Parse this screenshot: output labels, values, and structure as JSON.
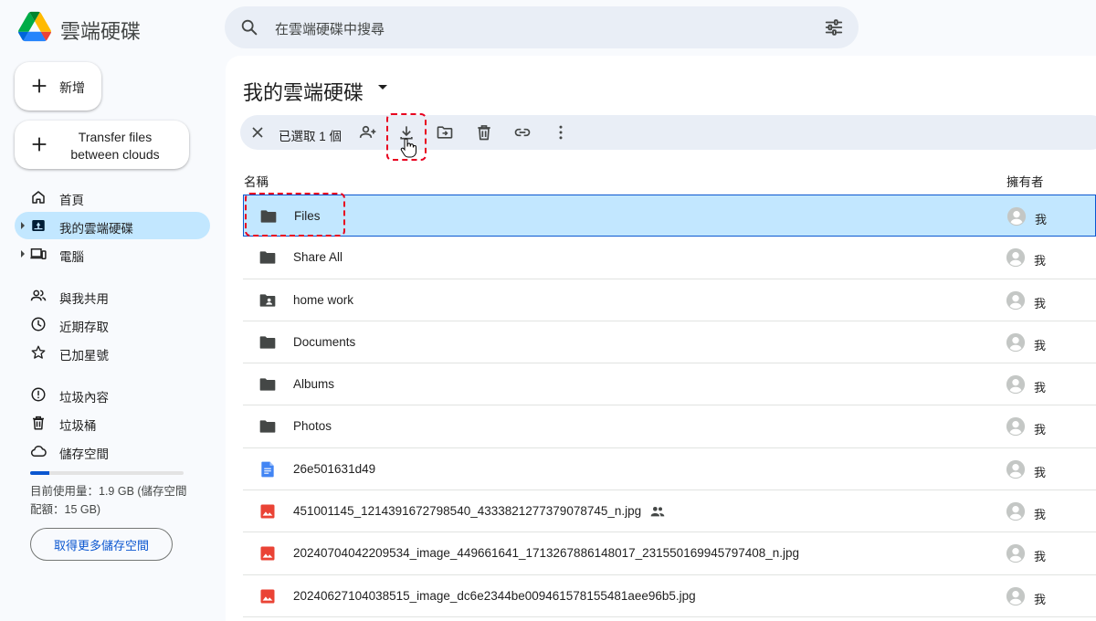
{
  "app": {
    "title": "雲端硬碟"
  },
  "search": {
    "placeholder": "在雲端硬碟中搜尋"
  },
  "sidebar": {
    "new_label": "新增",
    "transfer_label": "Transfer files between clouds",
    "items": [
      {
        "label": "首頁",
        "icon": "home-icon"
      },
      {
        "label": "我的雲端硬碟",
        "icon": "my-drive-icon",
        "active": true
      },
      {
        "label": "電腦",
        "icon": "computers-icon"
      },
      {
        "label": "與我共用",
        "icon": "shared-with-me-icon"
      },
      {
        "label": "近期存取",
        "icon": "recent-icon"
      },
      {
        "label": "已加星號",
        "icon": "star-icon"
      },
      {
        "label": "垃圾內容",
        "icon": "spam-icon"
      },
      {
        "label": "垃圾桶",
        "icon": "trash-icon"
      },
      {
        "label": "儲存空間",
        "icon": "cloud-icon"
      }
    ],
    "storage": {
      "used_fraction": 0.127,
      "text": "目前使用量：1.9 GB (儲存空間配額：15 GB)",
      "button": "取得更多儲存空間"
    }
  },
  "main": {
    "title": "我的雲端硬碟",
    "selection": {
      "count_label": "已選取 1 個"
    },
    "columns": {
      "name": "名稱",
      "owner": "擁有者"
    },
    "files": [
      {
        "name": "Files",
        "type": "folder",
        "owner": "我",
        "selected": true
      },
      {
        "name": "Share All",
        "type": "folder",
        "owner": "我"
      },
      {
        "name": "home work",
        "type": "shared-folder",
        "owner": "我"
      },
      {
        "name": "Documents",
        "type": "folder",
        "owner": "我"
      },
      {
        "name": "Albums",
        "type": "folder",
        "owner": "我"
      },
      {
        "name": "Photos",
        "type": "folder",
        "owner": "我"
      },
      {
        "name": "26e501631d49",
        "type": "doc",
        "owner": "我"
      },
      {
        "name": "451001145_1214391672798540_4333821277379078745_n.jpg",
        "type": "image",
        "owner": "我",
        "shared": true
      },
      {
        "name": "20240704042209534_image_449661641_1713267886148017_231550169945797408_n.jpg",
        "type": "image",
        "owner": "我"
      },
      {
        "name": "20240627104038515_image_dc6e2344be009461578155481aee96b5.jpg",
        "type": "image",
        "owner": "我"
      }
    ]
  },
  "colors": {
    "accent": "#0b57d0",
    "selected_bg": "#c2e7ff",
    "highlight": "#e8001f"
  }
}
